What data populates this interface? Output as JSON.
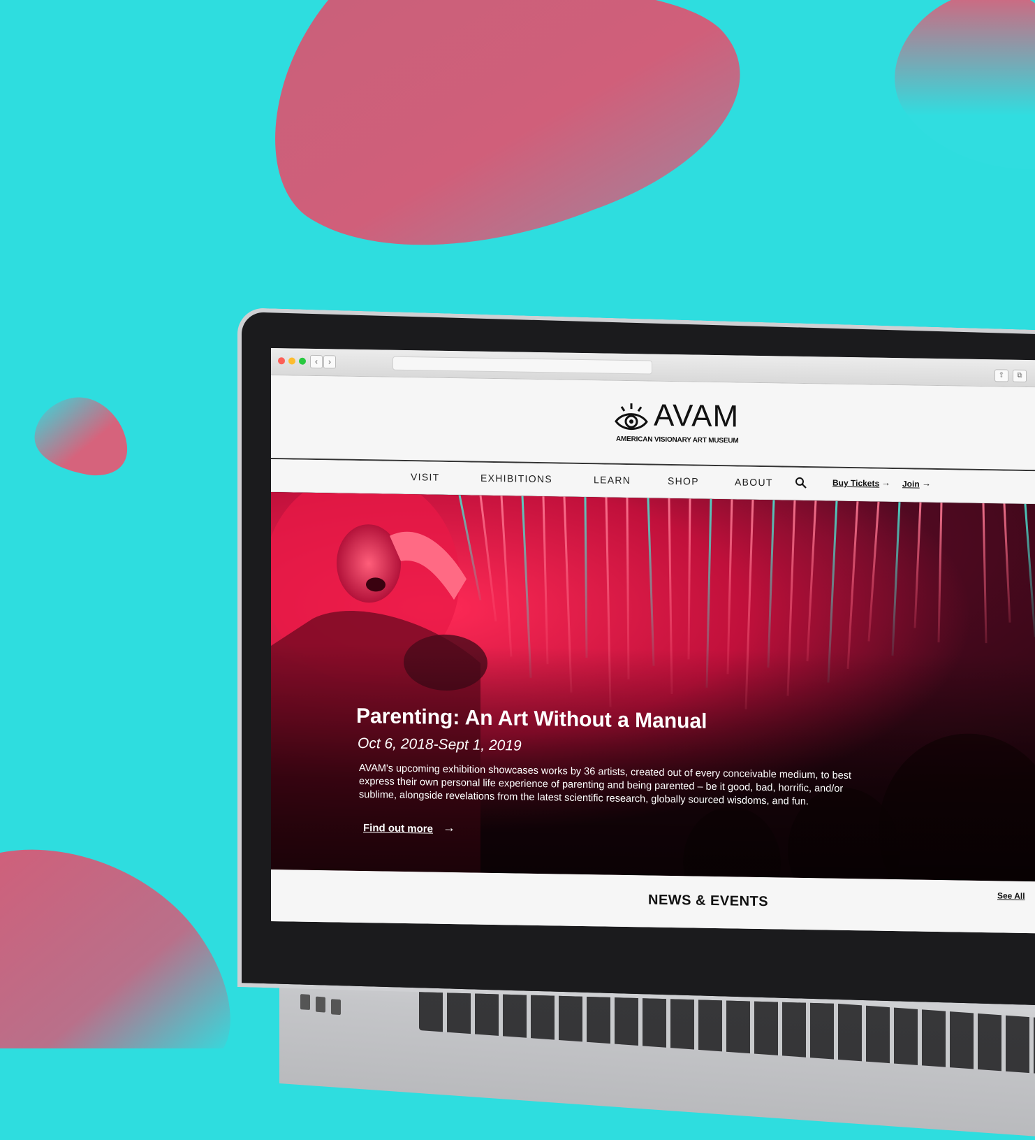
{
  "colors": {
    "background": "#2edddf",
    "blob": "#d3617a",
    "hero_pink": "#ff2a56",
    "hero_dark": "#2a0710"
  },
  "browser": {
    "back_icon": "‹",
    "forward_icon": "›",
    "share_icon": "⇪",
    "tabs_icon": "⧉"
  },
  "site": {
    "logo_word": "AVAM",
    "logo_sub": "AMERICAN VISIONARY ART MUSEUM",
    "logo_icon": "eye-icon"
  },
  "nav": {
    "items": [
      "VISIT",
      "EXHIBITIONS",
      "LEARN",
      "SHOP",
      "ABOUT"
    ],
    "search_icon": "search-icon",
    "buy_tickets": "Buy Tickets",
    "join": "Join",
    "arrow": "→"
  },
  "hero": {
    "title": "Parenting: An Art Without a Manual",
    "date": "Oct 6, 2018-Sept 1, 2019",
    "description": "AVAM's upcoming exhibition showcases works by 36 artists, created out of every conceivable medium, to best express their own personal life experience of parenting and being parented – be it good, bad, horrific, and/or sublime, alongside revelations from the latest scientific research, globally sourced wisdoms, and fun.",
    "cta": "Find out more",
    "arrow": "→"
  },
  "news": {
    "title": "NEWS & EVENTS",
    "see_all": "See All"
  }
}
